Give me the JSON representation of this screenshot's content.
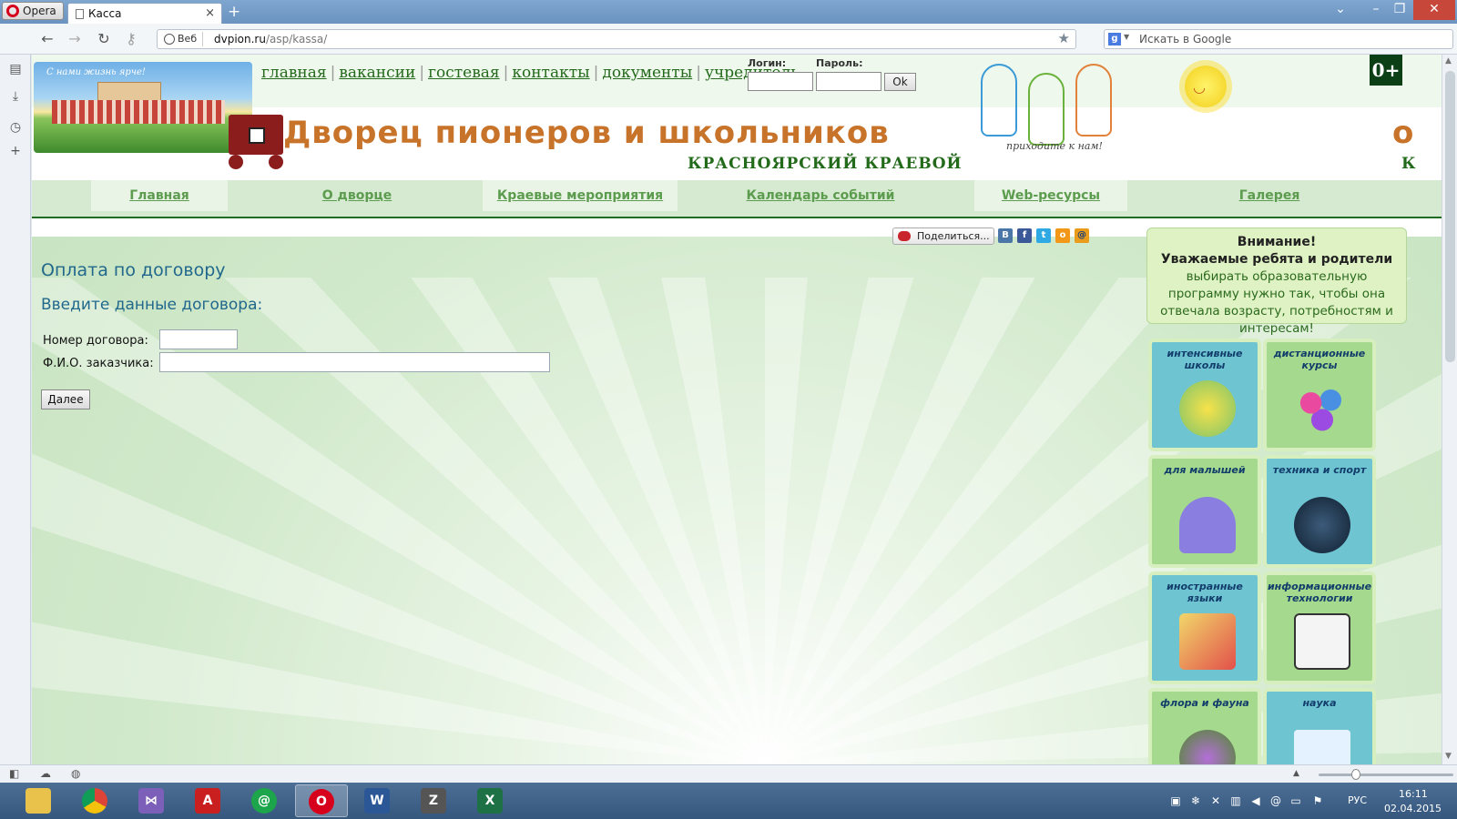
{
  "browser": {
    "menu_label": "Opera",
    "tab_title": "Касса",
    "tab_close": "×",
    "new_tab": "+",
    "address_scope": "Веб",
    "url_host": "dvpion.ru",
    "url_path": "/asp/kassa/",
    "search_placeholder": "Искать в Google"
  },
  "header": {
    "top_links": [
      "главная",
      "вакансии",
      "гостевая",
      "контакты",
      "документы",
      "учредитель"
    ],
    "login_label": "Логин:",
    "password_label": "Пароль:",
    "ok_label": "Ok",
    "age_badge": "0+",
    "kids_caption": "приходите к нам!",
    "title": "Дворец пионеров и школьников",
    "subtitle": "КРАСНОЯРСКИЙ КРАЕВОЙ",
    "title_clip": "о",
    "subtitle_clip": "К",
    "banner_text": "С нами жизнь ярче!"
  },
  "nav": {
    "items": [
      "Главная",
      "О дворце",
      "Краевые мероприятия",
      "Календарь событий",
      "Web-ресурсы",
      "Галерея"
    ]
  },
  "share": {
    "label": "Поделиться...",
    "networks": [
      "B",
      "f",
      "t",
      "o",
      "@"
    ]
  },
  "form": {
    "title": "Оплата по договору",
    "subtitle": "Введите данные договора:",
    "contract_label": "Номер договора:",
    "contract_value": "",
    "fio_label": "Ф.И.О. заказчика:",
    "fio_value": "",
    "next_label": "Далее"
  },
  "notice": {
    "heading": "Внимание!",
    "subheading": "Уважаемые ребята и родители",
    "body": "выбирать образовательную программу нужно так, чтобы она отвечала возрасту, потребностям и интересам!"
  },
  "tiles": [
    "интенсивные школы",
    "дистанционные курсы",
    "для малышей",
    "техника и спорт",
    "иностранные языки",
    "информационные технологии",
    "флора и фауна",
    "наука"
  ],
  "taskbar": {
    "lang": "РУС",
    "time": "16:11",
    "date": "02.04.2015"
  },
  "colors": {
    "link_green": "#236a1b",
    "nav_green": "#5c9c4e",
    "form_blue": "#21688c",
    "title_orange": "#c8732a"
  }
}
